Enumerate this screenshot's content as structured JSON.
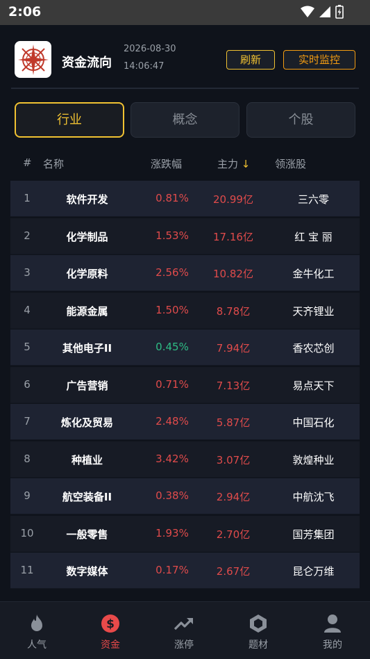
{
  "status_bar": {
    "time": "2:06"
  },
  "header": {
    "title": "资金流向",
    "date": "2026-08-30",
    "time": "14:06:47",
    "refresh_label": "刷新",
    "monitor_label": "实时监控"
  },
  "tabs": [
    {
      "label": "行业",
      "active": true
    },
    {
      "label": "概念",
      "active": false
    },
    {
      "label": "个股",
      "active": false
    }
  ],
  "table_header": {
    "index": "#",
    "name": "名称",
    "change": "涨跌幅",
    "main": "主力",
    "sort_arrow": "↓",
    "leader": "领涨股"
  },
  "rows": [
    {
      "index": "1",
      "name": "软件开发",
      "change": "0.81%",
      "main": "20.99亿",
      "leader": "三六零"
    },
    {
      "index": "2",
      "name": "化学制品",
      "change": "1.53%",
      "main": "17.16亿",
      "leader": "红 宝 丽"
    },
    {
      "index": "3",
      "name": "化学原料",
      "change": "2.56%",
      "main": "10.82亿",
      "leader": "金牛化工"
    },
    {
      "index": "4",
      "name": "能源金属",
      "change": "1.50%",
      "main": "8.78亿",
      "leader": "天齐锂业"
    },
    {
      "index": "5",
      "name": "其他电子II",
      "change": "0.45%",
      "main": "7.94亿",
      "leader": "香农芯创"
    },
    {
      "index": "6",
      "name": "广告营销",
      "change": "0.71%",
      "main": "7.13亿",
      "leader": "易点天下"
    },
    {
      "index": "7",
      "name": "炼化及贸易",
      "change": "2.48%",
      "main": "5.87亿",
      "leader": "中国石化"
    },
    {
      "index": "8",
      "name": "种植业",
      "change": "3.42%",
      "main": "3.07亿",
      "leader": "敦煌种业"
    },
    {
      "index": "9",
      "name": "航空装备II",
      "change": "0.38%",
      "main": "2.94亿",
      "leader": "中航沈飞"
    },
    {
      "index": "10",
      "name": "一般零售",
      "change": "1.93%",
      "main": "2.70亿",
      "leader": "国芳集团"
    },
    {
      "index": "11",
      "name": "数字媒体",
      "change": "0.17%",
      "main": "2.67亿",
      "leader": "昆仑万维"
    }
  ],
  "bottom_nav": [
    {
      "label": "人气",
      "icon": "flame-icon",
      "active": false
    },
    {
      "label": "资金",
      "icon": "dollar-icon",
      "active": true
    },
    {
      "label": "涨停",
      "icon": "trend-up-icon",
      "active": false
    },
    {
      "label": "题材",
      "icon": "hexagon-icon",
      "active": false
    },
    {
      "label": "我的",
      "icon": "user-icon",
      "active": false
    }
  ],
  "colors": {
    "accent": "#f1c232",
    "monitor_accent": "#f39c12",
    "up": "#e04b4b",
    "down": "#2ebd85",
    "active_nav": "#e84a4a"
  }
}
